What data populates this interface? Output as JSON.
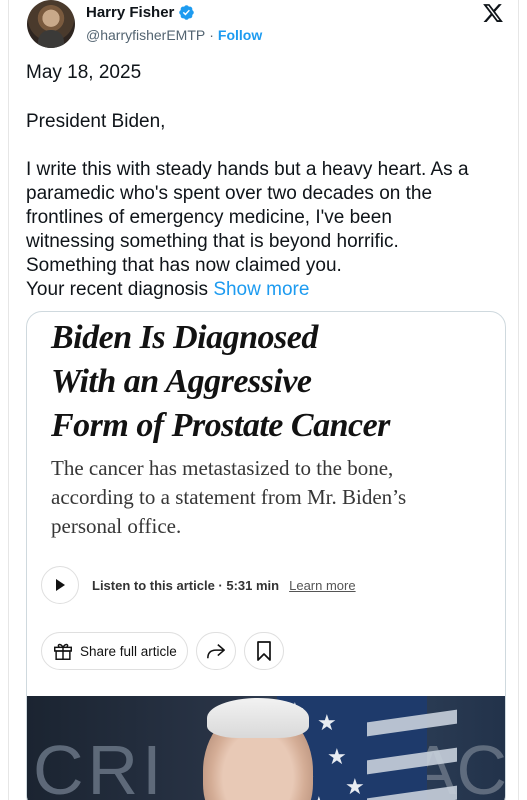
{
  "tweet": {
    "author_name": "Harry Fisher",
    "author_handle": "@harryfisherEMTP",
    "separator": "·",
    "follow_label": "Follow",
    "date": "May 18, 2025",
    "salutation": "President Biden,",
    "body_lines": [
      "I write this with steady hands but a heavy heart. As a",
      "paramedic who's spent over two decades on the",
      "frontlines of emergency medicine, I've been",
      "witnessing something that is beyond horrific.",
      "Something that has now claimed you."
    ],
    "last_line": "Your recent diagnosis",
    "show_more_label": "Show more"
  },
  "article": {
    "headline_lines": [
      "Biden Is Diagnosed",
      "With an Aggressive",
      "Form of Prostate Cancer"
    ],
    "dek_lines": [
      "The cancer has metastasized to the bone,",
      "according to a statement from Mr. Biden’s",
      "personal office."
    ],
    "listen_label": "Listen to this article · 5:31 min",
    "learn_more_label": "Learn more",
    "share_label": "Share full article",
    "photo_text_left": "CRI",
    "photo_text_right": "AC"
  },
  "colors": {
    "accent": "#1d9bf0",
    "text": "#0f1419",
    "muted": "#536471"
  },
  "icons": [
    "verified-badge-icon",
    "x-logo-icon",
    "play-icon",
    "gift-icon",
    "share-arrow-icon",
    "bookmark-icon"
  ]
}
